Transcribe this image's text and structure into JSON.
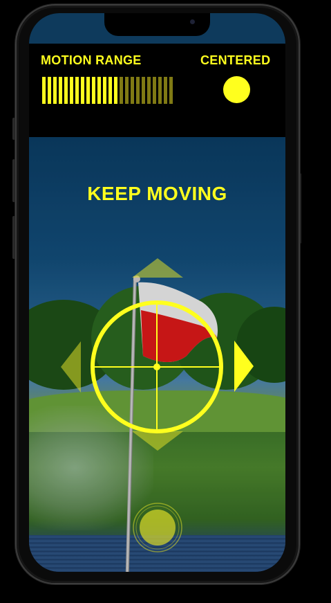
{
  "hud": {
    "motion_range_label": "MOTION RANGE",
    "centered_label": "CENTERED",
    "motion_range_level": 0.6,
    "centered_state": true
  },
  "viewfinder": {
    "instruction": "KEEP MOVING"
  },
  "colors": {
    "accent_yellow": "#ffff1e",
    "range_dim": "#807a14",
    "flag_red": "#e21a1a",
    "flag_white": "#f2f2f2"
  },
  "icons": {
    "arrow_up": "arrow-up-icon",
    "arrow_down": "arrow-down-icon",
    "arrow_left": "arrow-left-icon",
    "arrow_right": "arrow-right-icon",
    "reticle": "crosshair-icon",
    "shutter": "shutter-knob-icon"
  }
}
